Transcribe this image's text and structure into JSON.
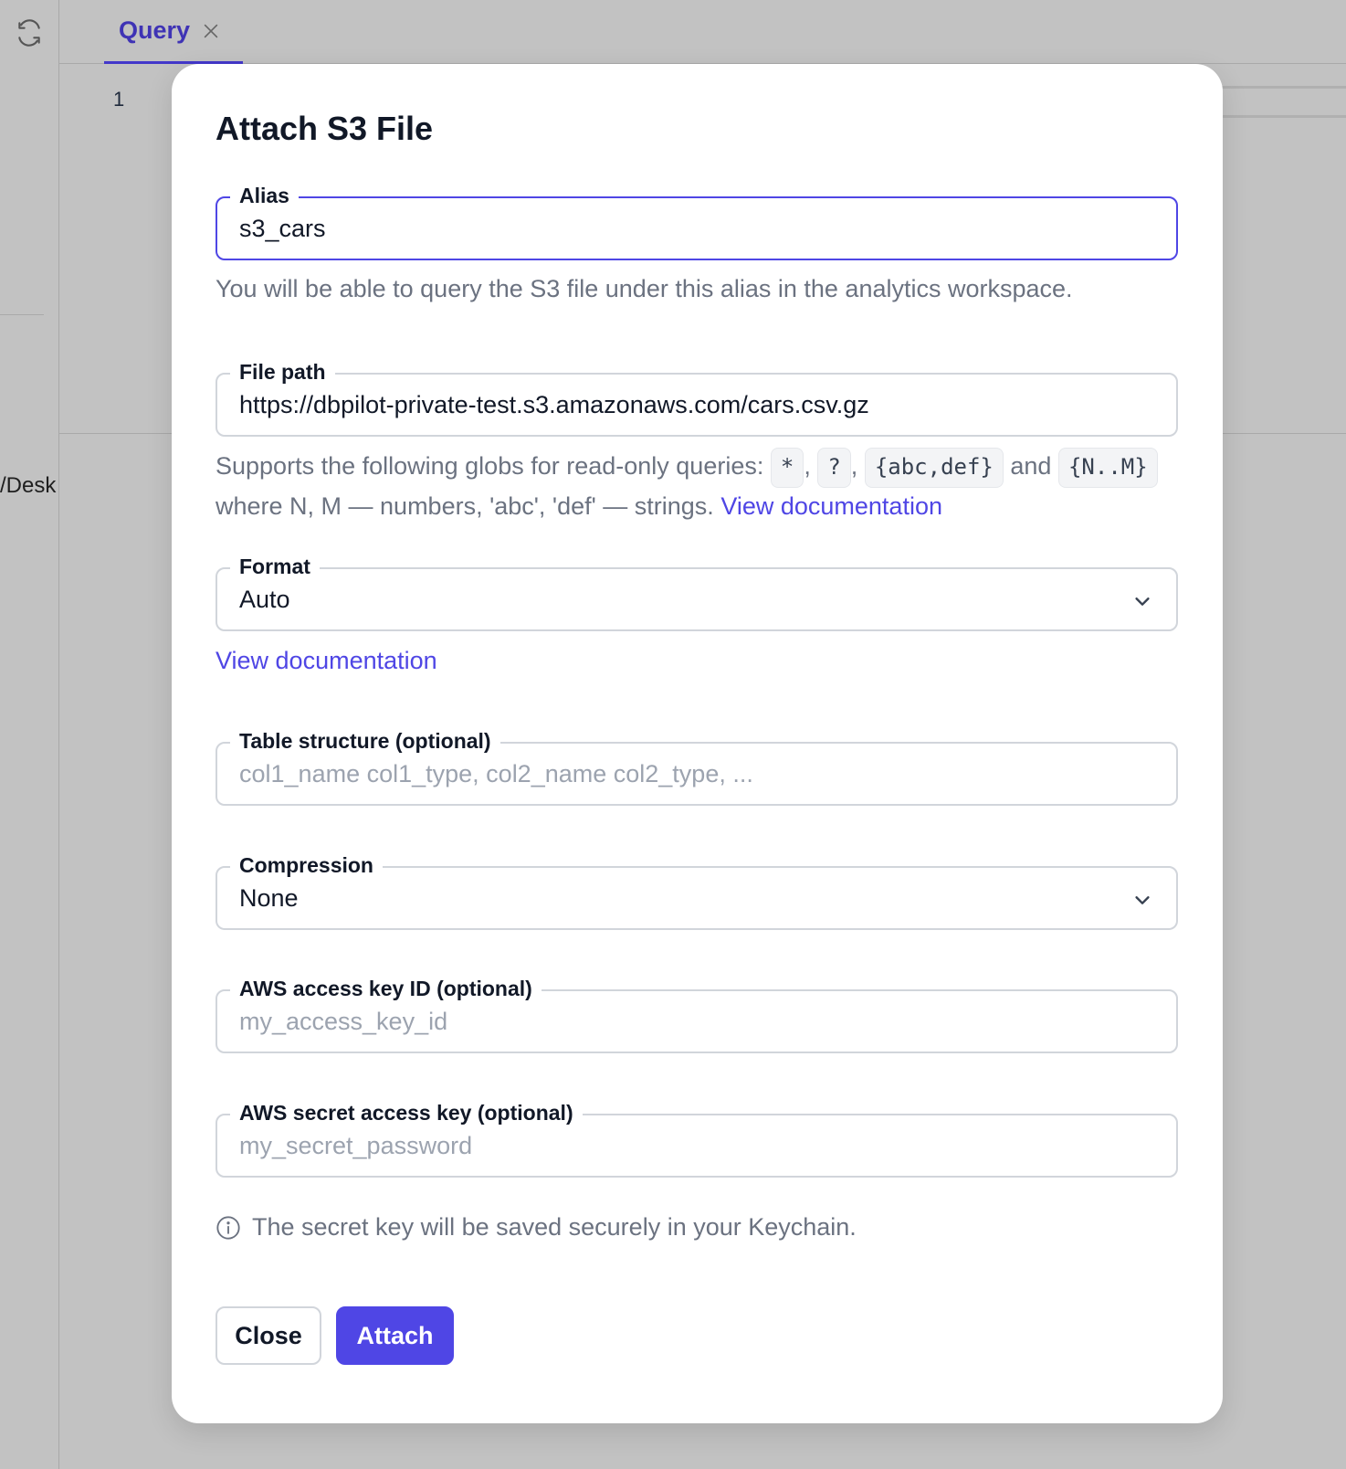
{
  "background": {
    "tab": {
      "label": "Query"
    },
    "editor": {
      "line_number": "1"
    },
    "left_panel": {
      "path_fragment": "/Desk"
    }
  },
  "modal": {
    "title": "Attach S3 File",
    "alias": {
      "label": "Alias",
      "value": "s3_cars",
      "help": "You will be able to query the S3 file under this alias in the analytics workspace."
    },
    "file_path": {
      "label": "File path",
      "value": "https://dbpilot-private-test.s3.amazonaws.com/cars.csv.gz",
      "help_prefix": "Supports the following globs for read-only queries:",
      "globs": [
        "*",
        "?",
        "{abc,def}",
        "{N..M}"
      ],
      "sep1": ",",
      "sep2": ",",
      "and_text": "and",
      "help_suffix": "where N, M — numbers, 'abc', 'def' — strings.",
      "doc_link": "View documentation"
    },
    "format": {
      "label": "Format",
      "value": "Auto",
      "doc_link": "View documentation"
    },
    "table_structure": {
      "label": "Table structure (optional)",
      "placeholder": "col1_name col1_type, col2_name col2_type, ..."
    },
    "compression": {
      "label": "Compression",
      "value": "None"
    },
    "aws_access_key_id": {
      "label": "AWS access key ID (optional)",
      "placeholder": "my_access_key_id"
    },
    "aws_secret_access_key": {
      "label": "AWS secret access key (optional)",
      "placeholder": "my_secret_password"
    },
    "info_note": "The secret key will be saved securely in your Keychain.",
    "buttons": {
      "close": "Close",
      "attach": "Attach"
    }
  },
  "colors": {
    "accent": "#4f46e5",
    "overlay": "#c2c2c2",
    "muted_text": "#6b7280",
    "border": "#d1d5db"
  }
}
